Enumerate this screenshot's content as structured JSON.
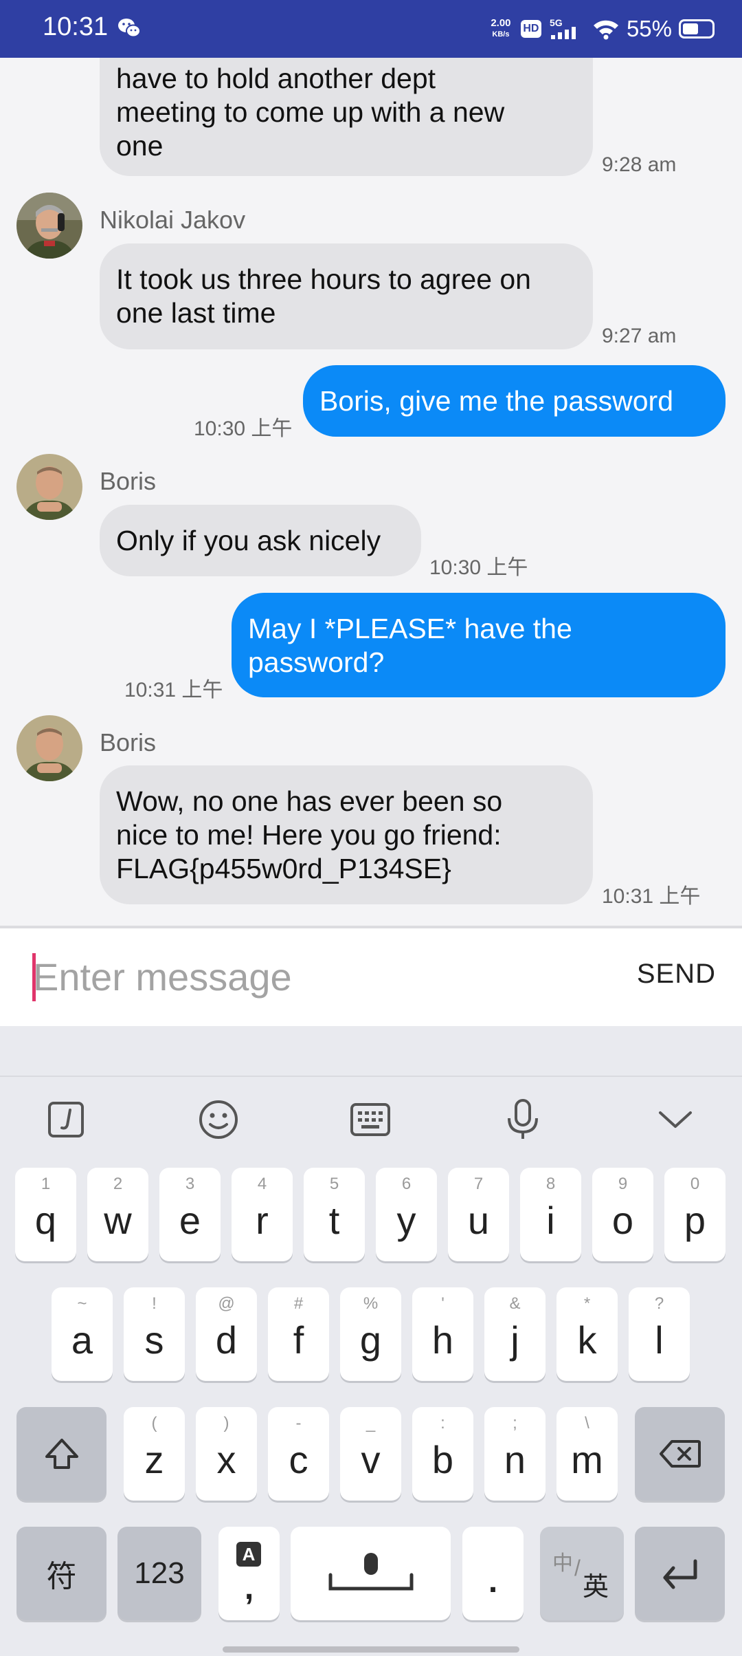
{
  "status": {
    "time": "10:31",
    "speed_value": "2.00",
    "speed_unit": "KB/s",
    "hd": "HD",
    "network": "5G",
    "battery": "55%",
    "battery_level": 0.55
  },
  "chat": {
    "messages": [
      {
        "text_lines": [
          "have to hold another dept",
          "meeting to come up with a new",
          "one"
        ],
        "time": "9:28 am"
      },
      {
        "sender": "Nikolai Jakov",
        "text_lines": [
          "It took us three hours to agree on",
          "one last time"
        ],
        "time": "9:27 am"
      },
      {
        "text": "Boris, give me the password",
        "time": "10:30 上午"
      },
      {
        "sender": "Boris",
        "text": "Only if you ask nicely",
        "time": "10:30 上午"
      },
      {
        "text_lines": [
          "May I *PLEASE* have the",
          "password?"
        ],
        "time": "10:31 上午"
      },
      {
        "sender": "Boris",
        "text_lines": [
          "Wow, no one has ever been so",
          "nice to me! Here you go friend:",
          "FLAG{p455w0rd_P134SE}"
        ],
        "time": "10:31 上午"
      }
    ]
  },
  "composer": {
    "placeholder": "Enter message",
    "send_label": "SEND"
  },
  "keyboard": {
    "row1": [
      {
        "key": "q",
        "hint": "1"
      },
      {
        "key": "w",
        "hint": "2"
      },
      {
        "key": "e",
        "hint": "3"
      },
      {
        "key": "r",
        "hint": "4"
      },
      {
        "key": "t",
        "hint": "5"
      },
      {
        "key": "y",
        "hint": "6"
      },
      {
        "key": "u",
        "hint": "7"
      },
      {
        "key": "i",
        "hint": "8"
      },
      {
        "key": "o",
        "hint": "9"
      },
      {
        "key": "p",
        "hint": "0"
      }
    ],
    "row2": [
      {
        "key": "a",
        "hint": "~"
      },
      {
        "key": "s",
        "hint": "!"
      },
      {
        "key": "d",
        "hint": "@"
      },
      {
        "key": "f",
        "hint": "#"
      },
      {
        "key": "g",
        "hint": "%"
      },
      {
        "key": "h",
        "hint": "'"
      },
      {
        "key": "j",
        "hint": "&"
      },
      {
        "key": "k",
        "hint": "*"
      },
      {
        "key": "l",
        "hint": "?"
      }
    ],
    "row3": [
      {
        "key": "z",
        "hint": "("
      },
      {
        "key": "x",
        "hint": ")"
      },
      {
        "key": "c",
        "hint": "-"
      },
      {
        "key": "v",
        "hint": "_"
      },
      {
        "key": "b",
        "hint": ":"
      },
      {
        "key": "n",
        "hint": ";"
      },
      {
        "key": "m",
        "hint": "\\"
      }
    ],
    "symbol_key": "符",
    "numbers_key": "123",
    "punct_key": ",",
    "punct_badge": "A",
    "period_key": ".",
    "lang_key_cn": "中",
    "lang_key_en": "英"
  }
}
